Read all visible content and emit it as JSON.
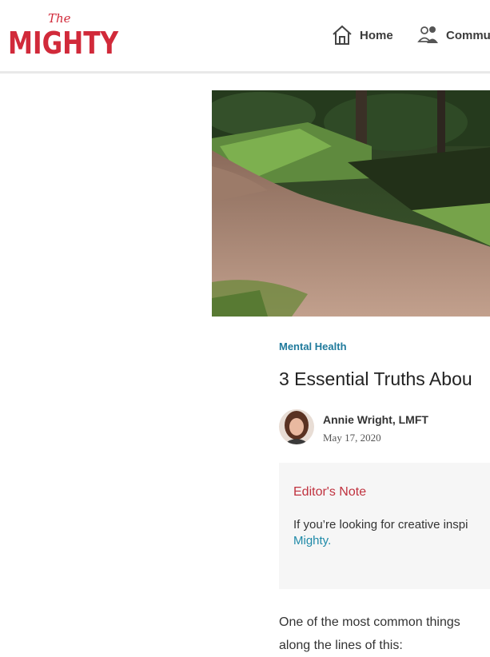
{
  "header": {
    "logo_the": "The",
    "logo_main": "MIGHTY",
    "nav": {
      "home_label": "Home",
      "home_icon": "home-icon",
      "community_label": "Commun",
      "community_icon": "community-icon"
    }
  },
  "article": {
    "category": "Mental Health",
    "title": "3 Essential Truths Abou",
    "author": {
      "name": "Annie Wright, LMFT",
      "date": "May 17, 2020"
    },
    "editor_note": {
      "title": "Editor's Note",
      "text_line1": "If you’re looking for creative inspi",
      "link_text": "Mighty."
    },
    "body_line1": "One of the most common things",
    "body_line2": "along the lines of this:"
  },
  "colors": {
    "brand": "#d12a3a",
    "link": "#1f7a9c",
    "editor_box": "#f6f6f6"
  }
}
